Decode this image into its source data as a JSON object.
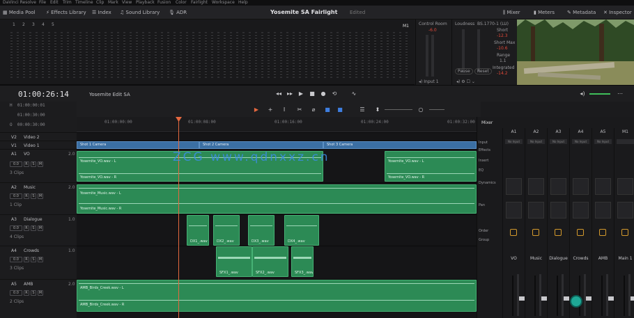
{
  "menubar": [
    "DaVinci Resolve",
    "File",
    "Edit",
    "Trim",
    "Timeline",
    "Clip",
    "Mark",
    "View",
    "Playback",
    "Fusion",
    "Color",
    "Fairlight",
    "Workspace",
    "Help"
  ],
  "toolbar": {
    "media_pool": "Media Pool",
    "effects_library": "Effects Library",
    "index": "Index",
    "sound_library": "Sound Library",
    "adr": "ADR",
    "project_title": "Yosemite SA Fairlight",
    "edited": "Edited",
    "mixer": "Mixer",
    "meters": "Meters",
    "metadata": "Metadata",
    "inspector": "Inspector"
  },
  "bridge": {
    "m1": "M1",
    "control_room": "Control Room",
    "control_room_value": "-6.0",
    "loudness": "Loudness",
    "loudness_scale": "BS.1770-1 (LU)",
    "short_label": "Short",
    "short_value": "-12.3",
    "short_max_label": "Short Max",
    "short_max_value": "-10.6",
    "range_label": "Range",
    "range_value": "1.1",
    "integrated_label": "Integrated",
    "integrated_value": "-14.2",
    "pause": "Pause",
    "reset": "Reset",
    "input": "Input 1",
    "track_nums": [
      "1",
      "2",
      "3",
      "4",
      "5"
    ]
  },
  "transport": {
    "timecode": "01:00:26:14",
    "timeline_name": "Yosemite Edit SA"
  },
  "tc_panel": [
    {
      "k": "H",
      "v": "01:00:00:01"
    },
    {
      "k": "",
      "v": "01:00:30:00"
    },
    {
      "k": "O",
      "v": "00:00:30:00"
    }
  ],
  "ruler": [
    "01:00:00:00",
    "01:00:08:00",
    "01:00:16:00",
    "01:00:24:00",
    "01:00:32:00"
  ],
  "tracks": [
    {
      "id": "V2",
      "name": "Video 2",
      "ch": "",
      "clips": ""
    },
    {
      "id": "V1",
      "name": "Video 1",
      "ch": "",
      "clips": ""
    },
    {
      "id": "A1",
      "name": "VO",
      "ch": "2.0",
      "gain": "0.0",
      "clips": "3 Clips"
    },
    {
      "id": "A2",
      "name": "Music",
      "ch": "2.0",
      "gain": "0.0",
      "clips": "1 Clip"
    },
    {
      "id": "A3",
      "name": "Dialogue",
      "ch": "1.0",
      "gain": "0.0",
      "clips": "4 Clips"
    },
    {
      "id": "A4",
      "name": "Crowds",
      "ch": "1.0",
      "gain": "0.0",
      "clips": "3 Clips"
    },
    {
      "id": "A5",
      "name": "AMB",
      "ch": "2.0",
      "gain": "0.0",
      "clips": "2 Clips"
    }
  ],
  "clips": {
    "v1": [
      "Shot 1 Camera",
      "Shot 2 Camera",
      "Shot 3 Camera"
    ],
    "vo": [
      "Yosemite_VO.wav - L",
      "Yosemite_VO.wav - R",
      "Yosemite_VO.wav - L",
      "Yosemite_VO.wav - R"
    ],
    "music": [
      "Yosemite_Music.wav - L",
      "Yosemite_Music.wav - R"
    ],
    "dialogue": [
      "DX1_.wav",
      "DX2_.wav",
      "DX3_.wav",
      "DX4_.wav"
    ],
    "crowds": [
      "SFX1_.wav",
      "SFX2_.wav",
      "SFX3_.wav"
    ],
    "amb": [
      "AMB_Birds_Creek.wav - L",
      "AMB_Birds_Creek.wav - R"
    ]
  },
  "mixer": {
    "title": "Mixer",
    "columns": [
      "A1",
      "A2",
      "A3",
      "A4",
      "A5",
      "M1"
    ],
    "row_labels": [
      "Input",
      "Effects",
      "Insert",
      "EQ",
      "Dynamics",
      "Pan",
      "Order",
      "Group"
    ],
    "inputs": [
      "No Input",
      "No Input",
      "No Input",
      "No Input",
      "No Input",
      ""
    ],
    "names": [
      "VO",
      "Music",
      "Dialogue",
      "Crowds",
      "AMB",
      "Main 1"
    ],
    "gain": [
      "0.0",
      "0.0",
      "0.0",
      "0.0",
      "0.0",
      "0.0"
    ]
  },
  "watermark": "ZCG www.qdnxxz.cn",
  "colors": {
    "accent": "#e5683f",
    "clip_green": "#2c8a55",
    "video_blue": "#3b6fa3",
    "group_orange": "#d49a2c"
  }
}
